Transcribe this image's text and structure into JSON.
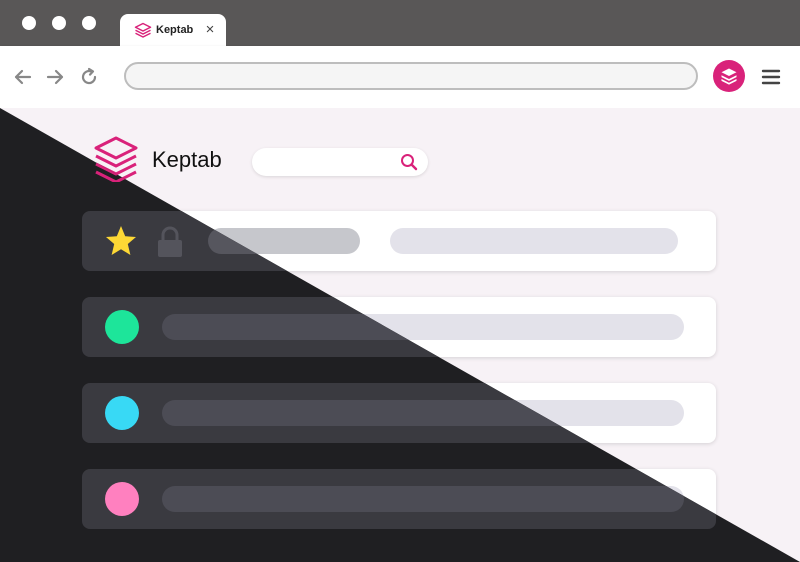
{
  "window": {
    "tab": {
      "title": "Keptab",
      "close_glyph": "×"
    }
  },
  "toolbar": {
    "back_icon": "arrow-left-icon",
    "forward_icon": "arrow-right-icon",
    "reload_icon": "reload-icon",
    "address_value": "",
    "extension_icon": "keptab-layers-icon",
    "menu_icon": "hamburger-menu-icon"
  },
  "app": {
    "name": "Keptab",
    "search": {
      "value": "",
      "placeholder": ""
    },
    "rows": [
      {
        "type": "pinned",
        "icons": [
          "star-icon",
          "lock-icon"
        ]
      },
      {
        "type": "group",
        "color": "#1de59a"
      },
      {
        "type": "group",
        "color": "#38d9f5"
      },
      {
        "type": "group",
        "color": "#ff80bf"
      }
    ]
  },
  "colors": {
    "accent": "#d9227a",
    "star": "#fdd835",
    "titlebar": "#595757",
    "dark_bg": "#1f1f22"
  }
}
